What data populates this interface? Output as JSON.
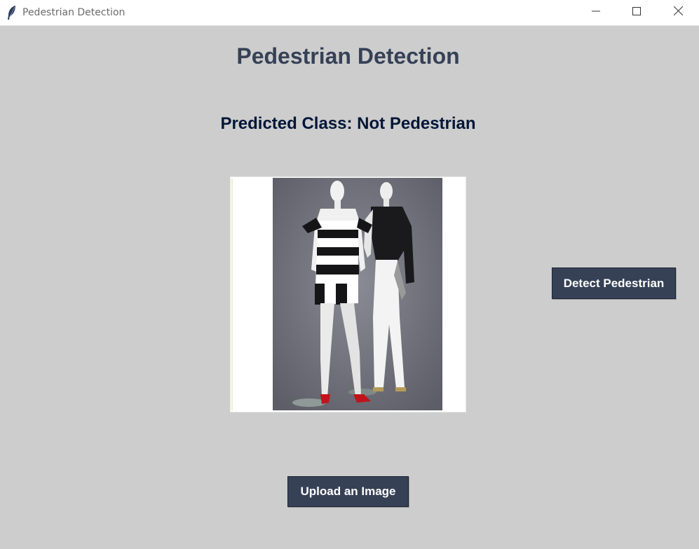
{
  "window": {
    "title": "Pedestrian Detection",
    "icon": "feather-icon",
    "controls": {
      "minimize_icon": "minimize-icon",
      "maximize_icon": "maximize-icon",
      "close_icon": "close-icon"
    }
  },
  "app": {
    "heading": "Pedestrian Detection",
    "predicted_class": "Predicted Class: Not Pedestrian",
    "image": {
      "description_icon": "mannequins-photo"
    },
    "detect_button_label": "Detect Pedestrian",
    "upload_button_label": "Upload an Image"
  },
  "colors": {
    "background": "#cdcdcd",
    "heading": "#364156",
    "predicted_text": "#011638",
    "button_bg": "#364156",
    "button_text": "#ffffff"
  }
}
